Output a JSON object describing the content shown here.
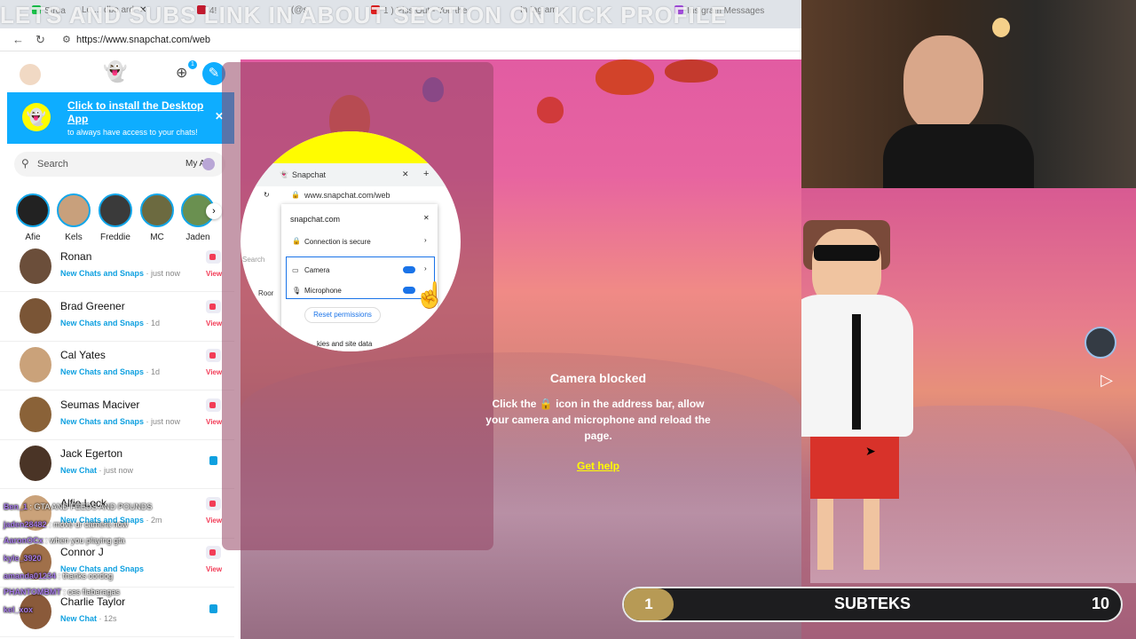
{
  "browser": {
    "tabs": [
      {
        "label": "Strea",
        "color": "#19c34a"
      },
      {
        "label": "Lo ... dbo ard",
        "color": "#3c3c3c"
      },
      {
        "label": "4!",
        "color": "#c21a2e"
      },
      {
        "label": "(@s",
        "color": "#cc4fa3"
      },
      {
        "label": "1 ) Piss Out - You the",
        "color": "#e02020"
      },
      {
        "label": "In tag am",
        "color": "#e1306c"
      },
      {
        "label": "Ins gram Messages",
        "color": "#a44dde"
      }
    ],
    "overlay_banner": "LETS AND SUBS LINK IN ABOUT SECTION ON KICK PROFILE",
    "url": "https://www.snapchat.com/web"
  },
  "sidebar": {
    "friend_badge": "1",
    "install_banner": {
      "title": "Click to install the Desktop App",
      "subtitle": "to always have access to your chats!"
    },
    "search": {
      "placeholder": "Search",
      "my_ai": "My AI"
    },
    "stories": [
      {
        "name": "Afie",
        "color": "#222"
      },
      {
        "name": "Kels",
        "color": "#c8a07c"
      },
      {
        "name": "Freddie",
        "color": "#3a3a3a"
      },
      {
        "name": "MC",
        "color": "#6c6a40"
      },
      {
        "name": "Jaden",
        "color": "#6a9050"
      }
    ],
    "chats": [
      {
        "name": "Ronan",
        "status": "New Chats and Snaps",
        "time": "just now",
        "view": "View",
        "kind": "snap",
        "avatar": "#6b4e3a"
      },
      {
        "name": "Brad Greener",
        "status": "New Chats and Snaps",
        "time": "1d",
        "view": "View",
        "kind": "snap",
        "avatar": "#7a5536"
      },
      {
        "name": "Cal Yates",
        "status": "New Chats and Snaps",
        "time": "1d",
        "view": "View",
        "kind": "snap",
        "avatar": "#caa27a"
      },
      {
        "name": "Seumas Maciver",
        "status": "New Chats and Snaps",
        "time": "just now",
        "view": "View",
        "kind": "snap",
        "avatar": "#8a6238"
      },
      {
        "name": "Jack Egerton",
        "status": "New Chat",
        "time": "just now",
        "view": "",
        "kind": "chat",
        "avatar": "#4a3426"
      },
      {
        "name": "Alfie Lock",
        "status": "New Chats and Snaps",
        "time": "2m",
        "view": "View",
        "kind": "snap",
        "avatar": "#caa27a"
      },
      {
        "name": "Connor J",
        "status": "New Chats and Snaps",
        "time": "",
        "view": "View",
        "kind": "snap",
        "avatar": "#a0704a"
      },
      {
        "name": "Charlie Taylor",
        "status": "New Chat",
        "time": "12s",
        "view": "",
        "kind": "chat",
        "avatar": "#8a5a3a"
      }
    ]
  },
  "stream_chat": [
    {
      "user": "Ben_1",
      "msg": "GTA AND FEEDS AND POUNDS"
    },
    {
      "user": "jaden28482",
      "msg": "move ur camera now"
    },
    {
      "user": "AaronOCx",
      "msg": "when you playing gta"
    },
    {
      "user": "kyle_3920",
      "msg": ""
    },
    {
      "user": "amanda01234",
      "msg": "thanks cordog"
    },
    {
      "user": "PHANTOMBMT",
      "msg": "ces flaberagas"
    },
    {
      "user": "kel_xox",
      "msg": ""
    }
  ],
  "main": {
    "illustration": {
      "tab_name": "Snapchat",
      "url": "www.snapchat.com/web",
      "site": "snapchat.com",
      "secure": "Connection is secure",
      "camera": "Camera",
      "microphone": "Microphone",
      "reset": "Reset permissions",
      "cookies": "kies and site data",
      "search_peek": "Search",
      "room_peek": "Roor"
    },
    "title": "Camera blocked",
    "body_pre": "Click the",
    "body_post": "icon in the address bar, allow your camera and microphone and reload the page.",
    "help": "Get help"
  },
  "sub_goal": {
    "current": "1",
    "label": "SUBTEKS",
    "target": "10",
    "progress": 0.1
  },
  "colors": {
    "snap_blue": "#0eadff",
    "snap_yellow": "#fffc00",
    "snap_red": "#f23c57"
  }
}
